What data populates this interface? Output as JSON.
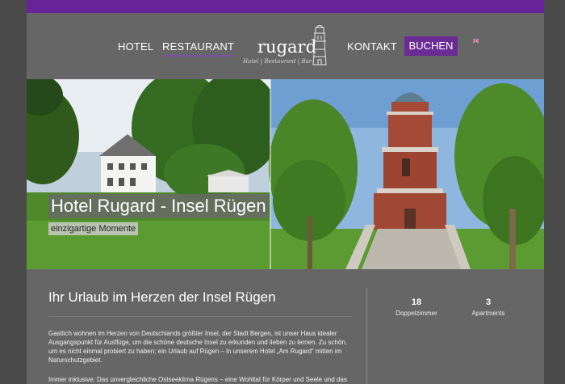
{
  "nav": {
    "hotel": "HOTEL",
    "restaurant": "RESTAURANT",
    "kontakt": "KONTAKT",
    "buchen": "BUCHEN"
  },
  "logo": {
    "word": "rugard",
    "sub": "Hotel | Restaurant | Bar"
  },
  "hero": {
    "title": "Hotel Rugard - Insel Rügen",
    "subtitle": "einzigartige Momente"
  },
  "intro": {
    "title": "Ihr Urlaub im Herzen der Insel Rügen",
    "para1": "Gastlich wohnen im Herzen von Deutschlands größter Insel, der Stadt Bergen, ist unser Haus idealer Ausgangspunkt für Ausflüge, um die schöne deutsche Insel zu erkunden und lieben zu lernen. Zu schön, um es nicht einmal probiert zu haben; ein Urlaub auf Rügen – in unserem Hotel „Am Rugard“ mitten im Naturschutzgebiet.",
    "para2": "Immer inklusive: Das unvergleichliche Ostseeklima Rügens – eine Wohltat für Körper und Seele und das"
  },
  "stats": [
    {
      "value": "18",
      "label": "Doppelzimmer"
    },
    {
      "value": "3",
      "label": "Apartments"
    }
  ],
  "colors": {
    "accent": "#66239a",
    "button": "#6b2b95",
    "page_bg": "#666666"
  },
  "icons": {
    "language_flag": "uk-flag-icon",
    "logo_tower": "tower-icon"
  }
}
